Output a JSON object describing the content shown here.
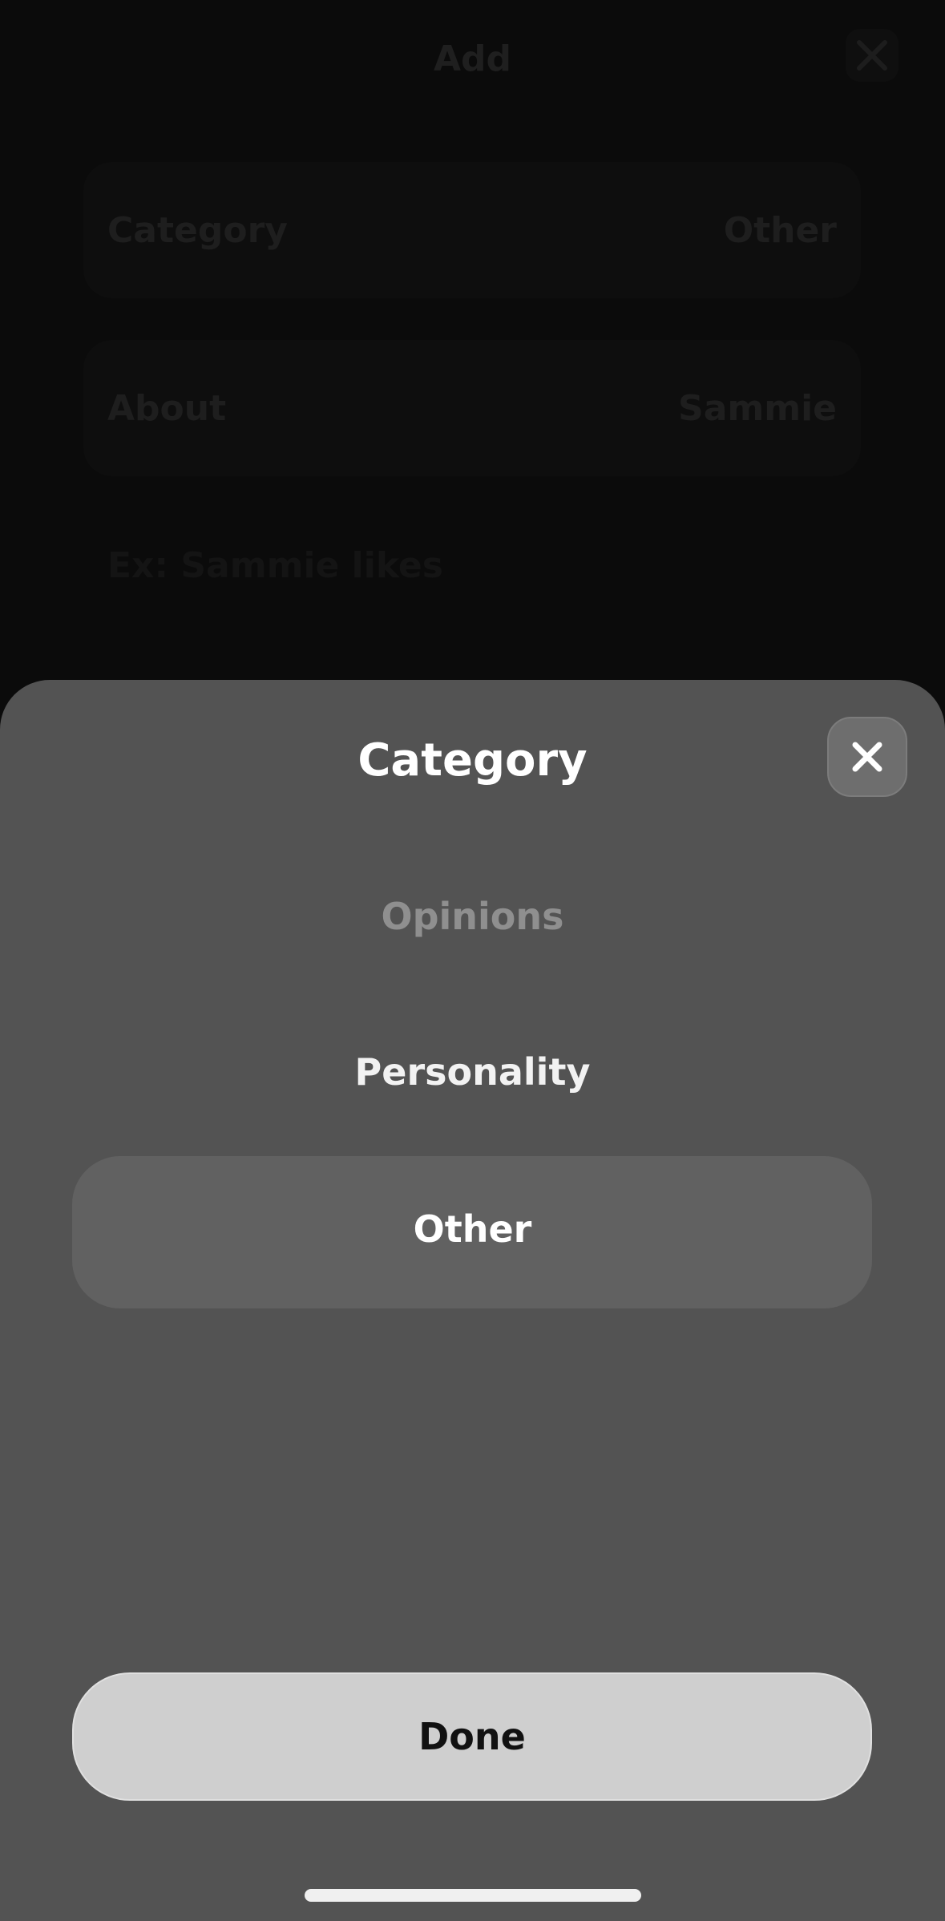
{
  "background": {
    "title": "Add",
    "rows": [
      {
        "label": "Category",
        "value": "Other"
      },
      {
        "label": "About",
        "value": "Sammie"
      }
    ],
    "placeholder": "Ex: Sammie likes"
  },
  "sheet": {
    "title": "Category",
    "options": [
      "Opinions",
      "Personality",
      "Other"
    ],
    "selected": "Other",
    "done_label": "Done"
  },
  "icons": {
    "close": "close-icon",
    "bg_close": "close-icon"
  }
}
